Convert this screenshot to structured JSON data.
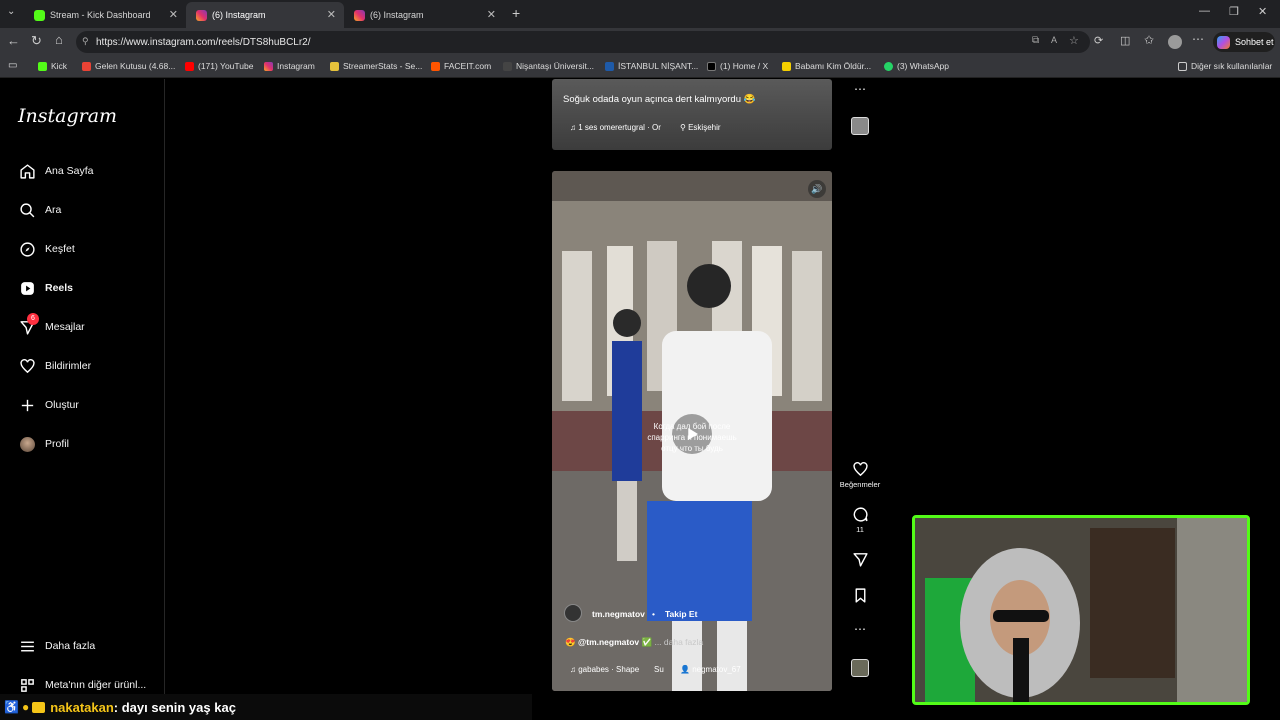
{
  "browser": {
    "tabs": [
      {
        "title": "Stream - Kick Dashboard",
        "icon": "kick-icon"
      },
      {
        "title": "(6) Instagram",
        "icon": "instagram-icon"
      },
      {
        "title": "(6) Instagram",
        "icon": "instagram-icon"
      }
    ],
    "url": "https://www.instagram.com/reels/DTS8huBCLr2/",
    "copilot_label": "Sohbet et",
    "bookmarks": [
      "Kick",
      "Gelen Kutusu (4.68...",
      "(171) YouTube",
      "Instagram",
      "StreamerStats - Se...",
      "FACEIT.com",
      "Nişantaşı Üniversit...",
      "İSTANBUL NİŞANT...",
      "(1) Home / X",
      "Babamı Kim Öldür...",
      "(3) WhatsApp"
    ],
    "other_bookmarks": "Diğer sık kullanılanlar"
  },
  "instagram": {
    "logo": "Instagram",
    "nav": [
      {
        "label": "Ana Sayfa",
        "icon": "home-icon"
      },
      {
        "label": "Ara",
        "icon": "search-icon"
      },
      {
        "label": "Keşfet",
        "icon": "compass-icon"
      },
      {
        "label": "Reels",
        "icon": "reels-icon"
      },
      {
        "label": "Mesajlar",
        "icon": "messenger-icon",
        "badge": "6"
      },
      {
        "label": "Bildirimler",
        "icon": "heart-icon"
      },
      {
        "label": "Oluştur",
        "icon": "plus-icon"
      },
      {
        "label": "Profil",
        "icon": "avatar"
      }
    ],
    "more": "Daha fazla",
    "meta": "Meta'nın diğer ürünl..."
  },
  "reel_top": {
    "caption": "Soğuk odada oyun açınca dert kalmıyordu 😂",
    "audio": "1 ses  omerertugral · Or",
    "location": "Eskişehir"
  },
  "reel_main": {
    "overlay_text_1": "Когда дал бой после",
    "overlay_text_2": "спарринга и понимаешь",
    "overlay_text_3": "отцу что ты будь",
    "username": "tm.negmatov",
    "follow": "Takip Et",
    "caption_user": "@tm.negmatov",
    "more": "... daha fazla",
    "audio": "gababes · Shape",
    "audio_extra": "Su",
    "tagged": "negmatov_67"
  },
  "actions": {
    "likes_label": "Beğenmeler",
    "comments_count": "11"
  },
  "chat": {
    "user": "nakatakan",
    "message": " : dayı senin yaş kaç",
    "user_color": "#f5c518"
  }
}
